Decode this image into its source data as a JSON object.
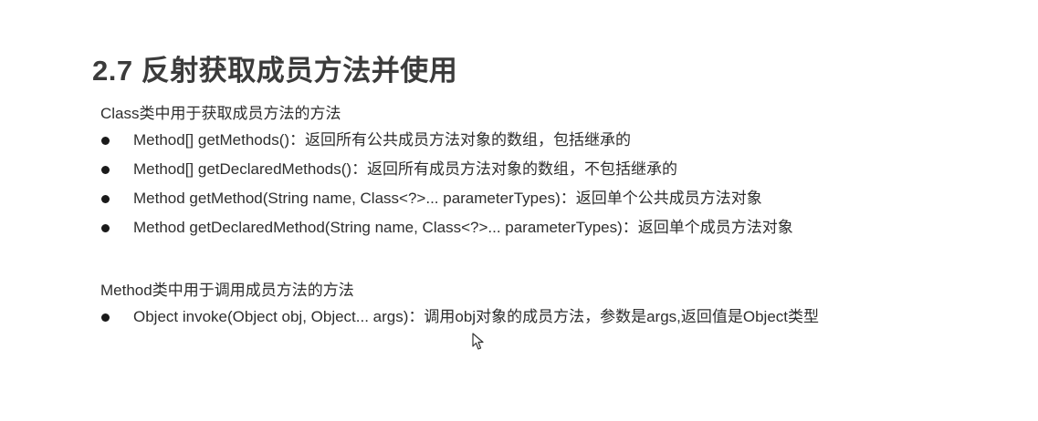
{
  "title": "2.7 反射获取成员方法并使用",
  "section1": {
    "label": "Class类中用于获取成员方法的方法",
    "items": [
      "Method[] getMethods()：返回所有公共成员方法对象的数组，包括继承的",
      "Method[] getDeclaredMethods()：返回所有成员方法对象的数组，不包括继承的",
      "Method getMethod(String name, Class<?>... parameterTypes)：返回单个公共成员方法对象",
      "Method getDeclaredMethod(String name, Class<?>... parameterTypes)：返回单个成员方法对象"
    ]
  },
  "section2": {
    "label": "Method类中用于调用成员方法的方法",
    "items": [
      "Object invoke(Object obj, Object... args)：调用obj对象的成员方法，参数是args,返回值是Object类型"
    ]
  },
  "icons": {
    "bullet": "filled-circle-bullet",
    "pointer": "mouse-pointer-icon"
  }
}
